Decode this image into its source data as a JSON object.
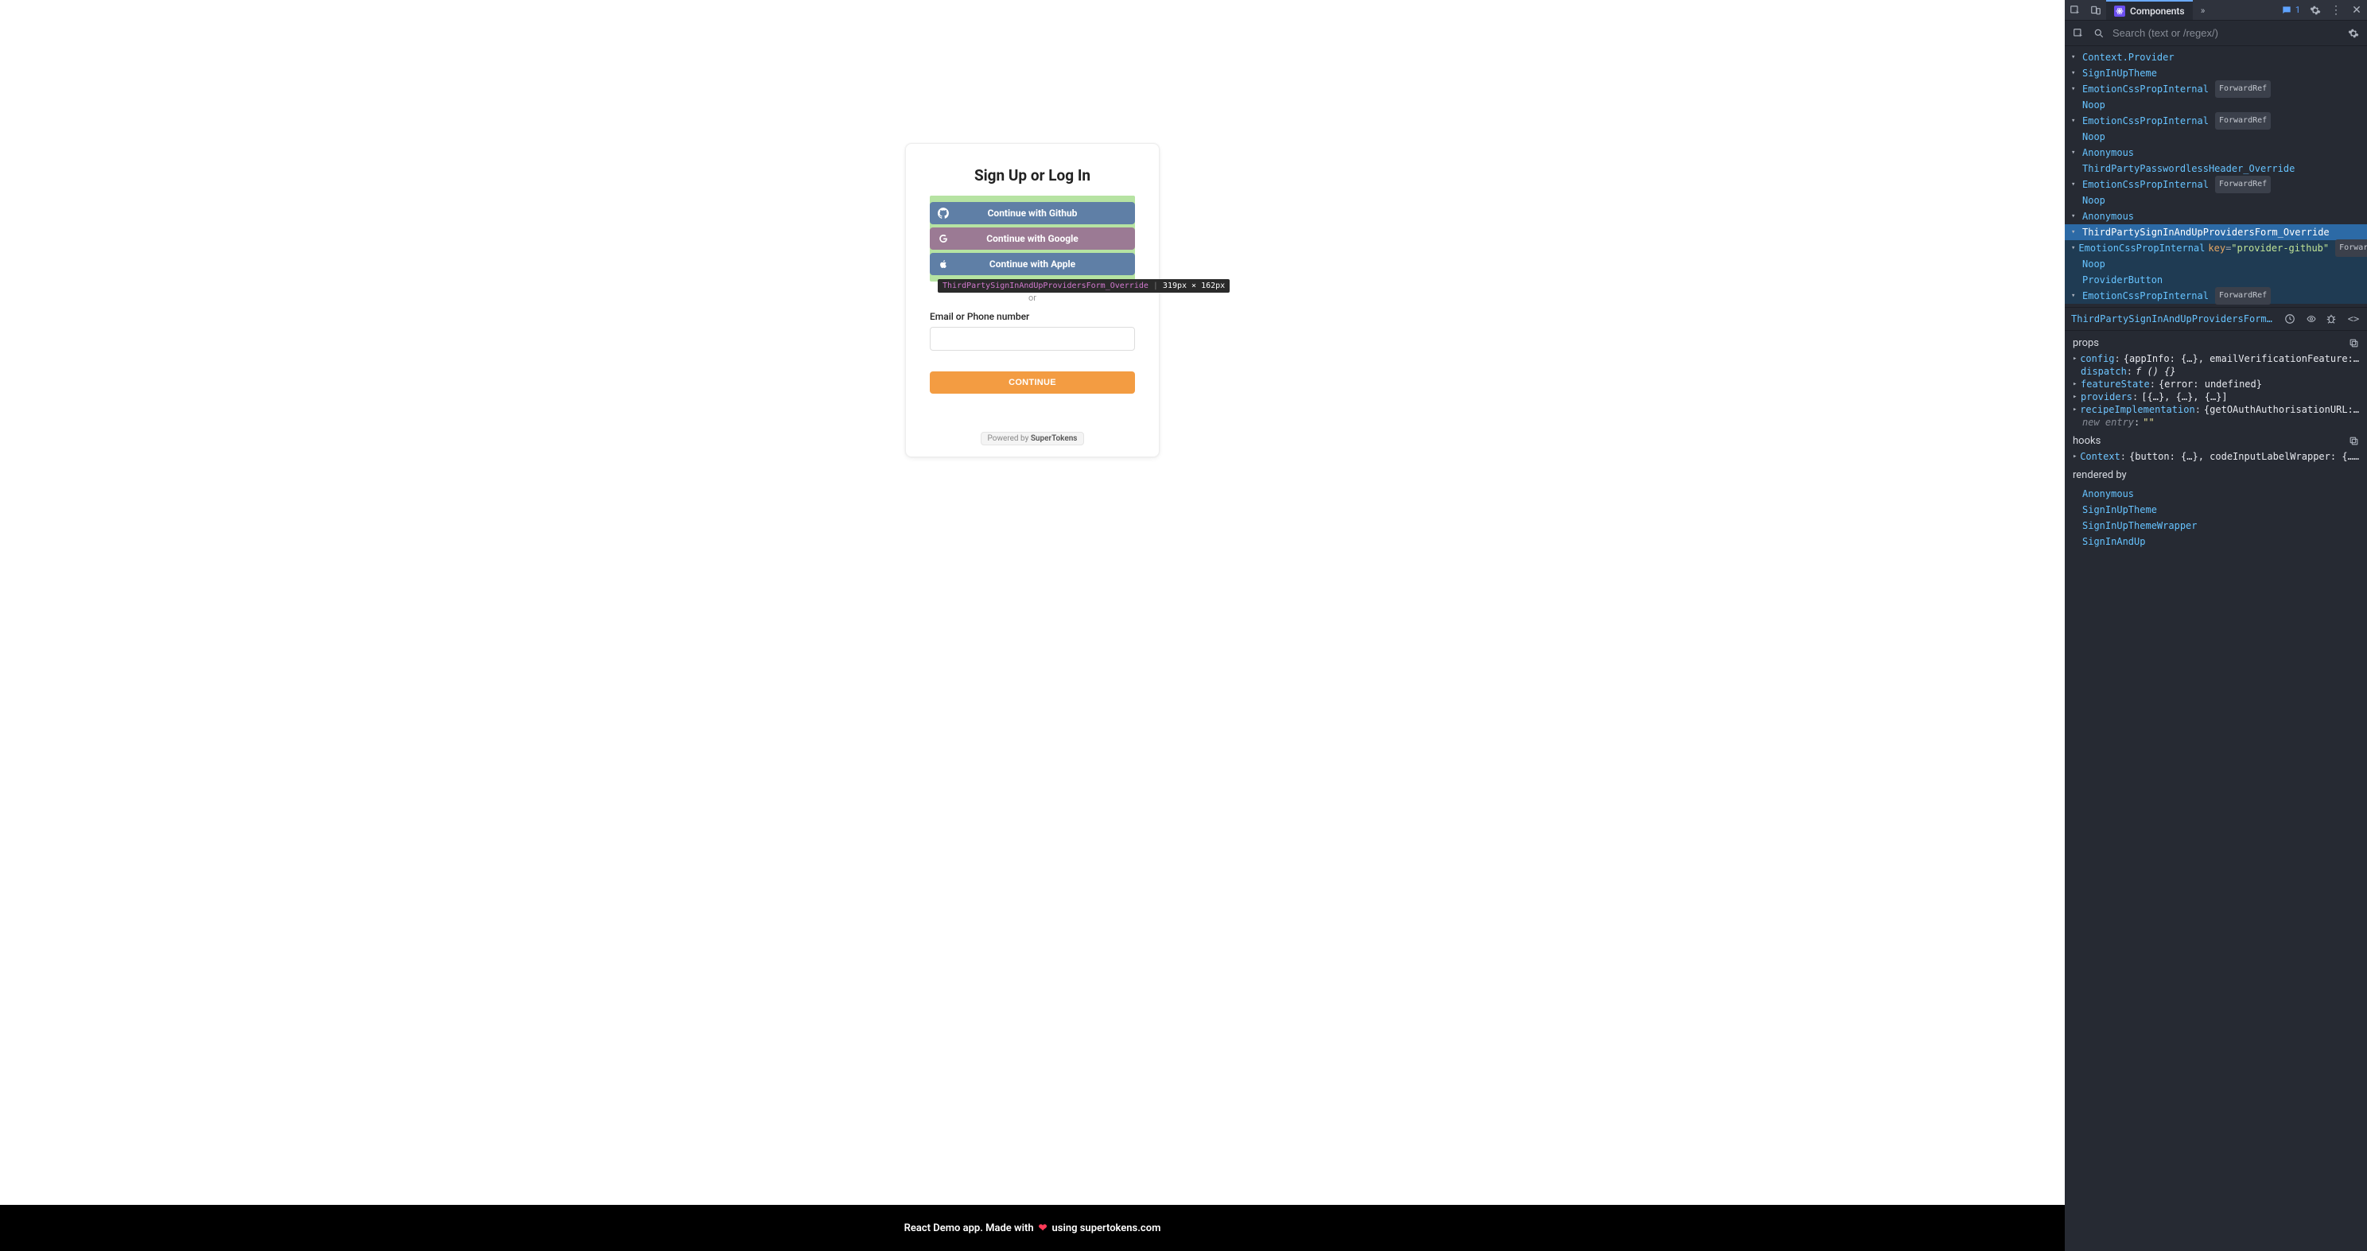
{
  "auth": {
    "title": "Sign Up or Log In",
    "providers": {
      "github": "Continue with Github",
      "google": "Continue with Google",
      "apple": "Continue with Apple"
    },
    "or": "or",
    "email_label": "Email or Phone number",
    "continue": "CONTINUE",
    "powered_prefix": "Powered by ",
    "powered_brand": "SuperTokens"
  },
  "inspect_tooltip": {
    "component": "ThirdPartySignInAndUpProvidersForm_Override",
    "dims": "319px × 162px"
  },
  "footer": {
    "left": "React Demo app. Made with",
    "right": "using supertokens.com"
  },
  "devtools": {
    "tab_label": "Components",
    "badge_count": "1",
    "search_placeholder": "Search (text or /regex/)",
    "tree": [
      {
        "indent": 0,
        "caret": true,
        "name": "Context.Provider"
      },
      {
        "indent": 0,
        "caret": true,
        "name": "SignInUpTheme"
      },
      {
        "indent": 0,
        "caret": true,
        "name": "EmotionCssPropInternal",
        "pill": "ForwardRef"
      },
      {
        "indent": 0,
        "caret": false,
        "name": "Noop"
      },
      {
        "indent": 0,
        "caret": true,
        "name": "EmotionCssPropInternal",
        "pill": "ForwardRef"
      },
      {
        "indent": 0,
        "caret": false,
        "name": "Noop"
      },
      {
        "indent": 0,
        "caret": true,
        "name": "Anonymous"
      },
      {
        "indent": 0,
        "caret": false,
        "name": "ThirdPartyPasswordlessHeader_Override"
      },
      {
        "indent": 0,
        "caret": true,
        "name": "EmotionCssPropInternal",
        "pill": "ForwardRef"
      },
      {
        "indent": 0,
        "caret": false,
        "name": "Noop"
      },
      {
        "indent": 0,
        "caret": true,
        "name": "Anonymous"
      },
      {
        "indent": 0,
        "caret": true,
        "name": "ThirdPartySignInAndUpProvidersForm_Override",
        "selected": true
      },
      {
        "indent": 0,
        "caret": true,
        "name": "EmotionCssPropInternal",
        "key": "provider-github",
        "pill": "Forward",
        "dimsel": true
      },
      {
        "indent": 0,
        "caret": false,
        "name": "Noop",
        "dimsel": true
      },
      {
        "indent": 0,
        "caret": false,
        "name": "ProviderButton",
        "dimsel": true
      },
      {
        "indent": 0,
        "caret": true,
        "name": "EmotionCssPropInternal",
        "pill": "ForwardRef",
        "dimsel": true
      }
    ],
    "selected_path": "ThirdPartySignInAndUpProvidersForm_O…",
    "props_label": "props",
    "props": [
      {
        "k": "config",
        "v": "{appInfo: {…}, emailVerificationFeature:…",
        "caret": true
      },
      {
        "k": "dispatch",
        "v": "f () {}",
        "fn": true
      },
      {
        "k": "featureState",
        "v": "{error: undefined}",
        "caret": true
      },
      {
        "k": "providers",
        "v": "[{…}, {…}, {…}]",
        "caret": true
      },
      {
        "k": "recipeImplementation",
        "v": "{getOAuthAuthorisationURL:…",
        "caret": true
      }
    ],
    "new_entry_label": "new entry",
    "new_entry_value": "\"\"",
    "hooks_label": "hooks",
    "hooks": [
      {
        "k": "Context",
        "v": "{button: {…}, codeInputLabelWrapper: {……",
        "caret": true
      }
    ],
    "rendered_by_label": "rendered by",
    "rendered_by": [
      "Anonymous",
      "SignInUpTheme",
      "SignInUpThemeWrapper",
      "SignInAndUp"
    ]
  }
}
